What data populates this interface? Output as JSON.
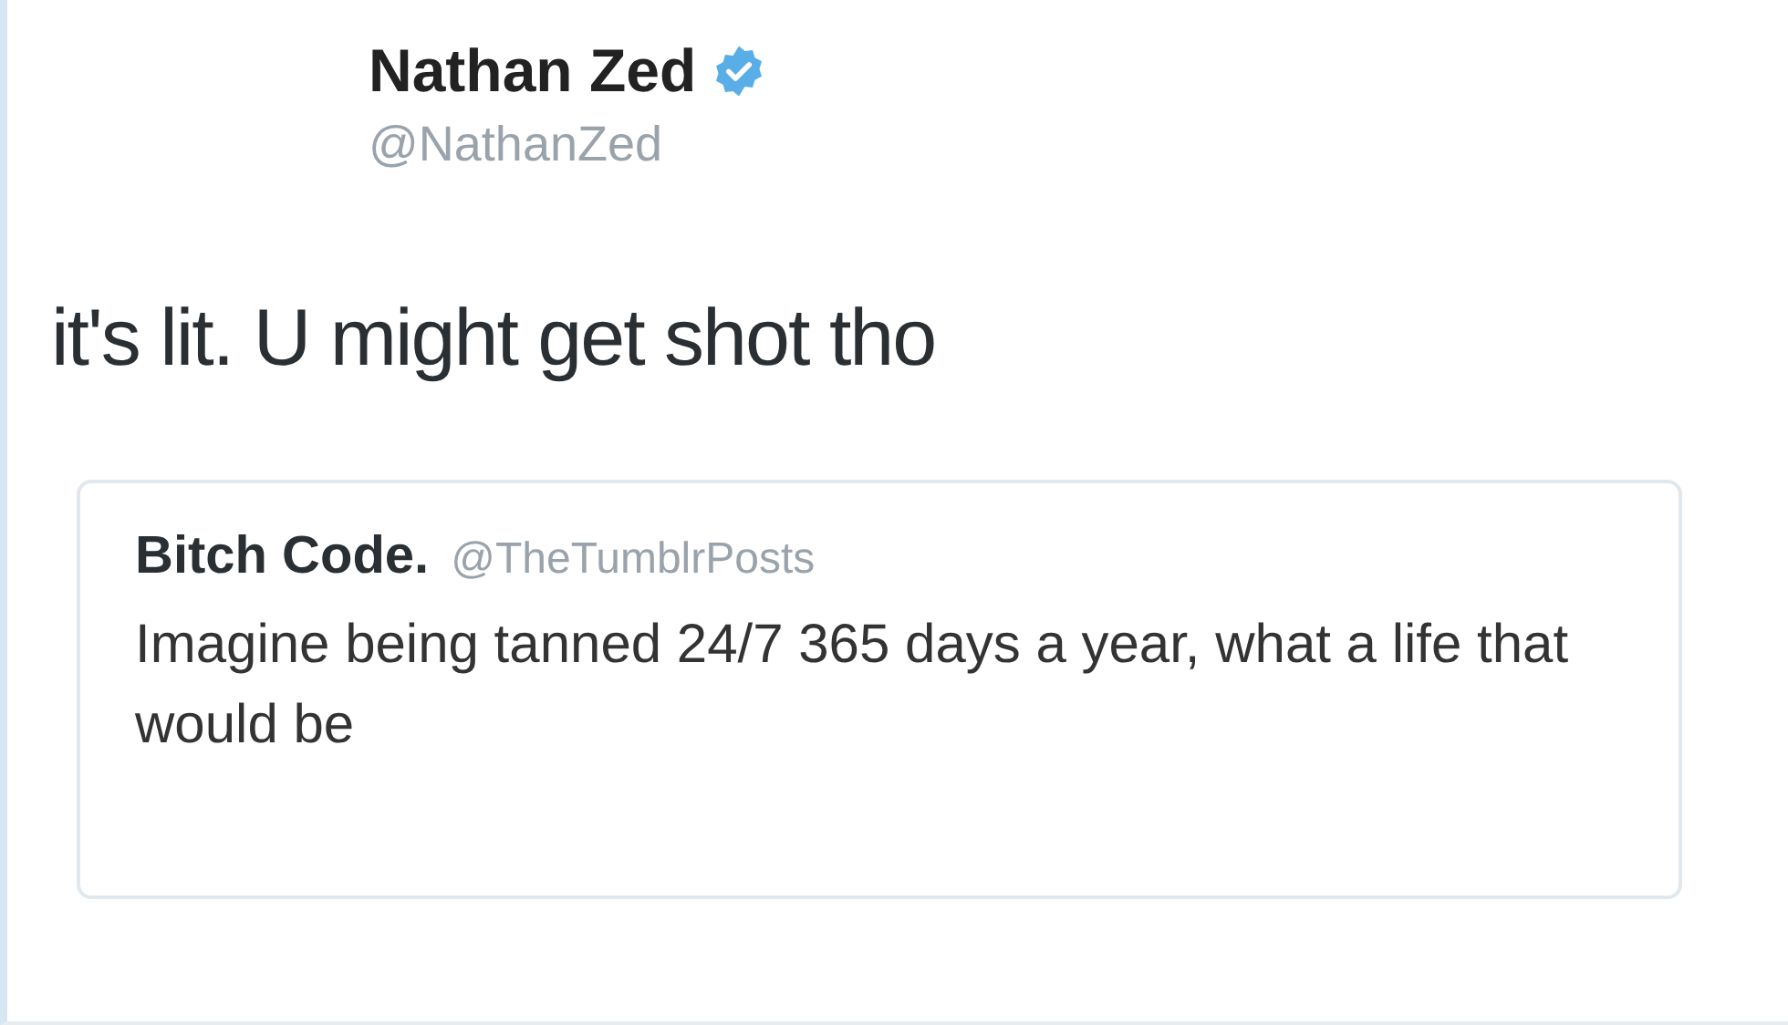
{
  "author": {
    "name": "Nathan Zed",
    "verified": true,
    "handle": "@NathanZed"
  },
  "tweet_text": "it's lit. U might get shot tho",
  "quoted_tweet": {
    "name": "Bitch Code.",
    "handle": "@TheTumblrPosts",
    "text": "Imagine being tanned 24/7 365 days a year, what a life that would be"
  }
}
